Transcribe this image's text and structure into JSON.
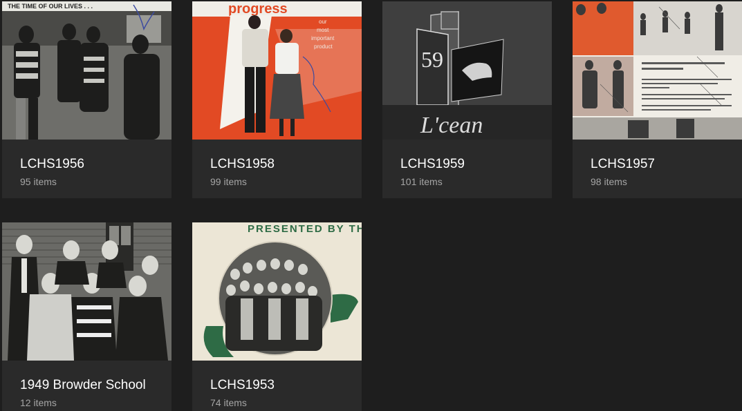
{
  "albums": [
    {
      "title": "LCHS1956",
      "count": "95 items",
      "cover_text": "THE TIME OF OUR LIVES . . ."
    },
    {
      "title": "LCHS1958",
      "count": "99 items",
      "cover_text": "progress",
      "cover_subtext": [
        "our",
        "most",
        "important",
        "product"
      ],
      "accent": "#e24a24"
    },
    {
      "title": "LCHS1959",
      "count": "101 items",
      "cover_text": "L'cean",
      "cover_number": "59"
    },
    {
      "title": "LCHS1957",
      "count": "98 items",
      "accent": "#e05a2e"
    },
    {
      "title": "1949 Browder School",
      "count": "12 items"
    },
    {
      "title": "LCHS1953",
      "count": "74 items",
      "cover_text": "PRESENTED BY THE",
      "accent": "#2e6b45"
    }
  ]
}
